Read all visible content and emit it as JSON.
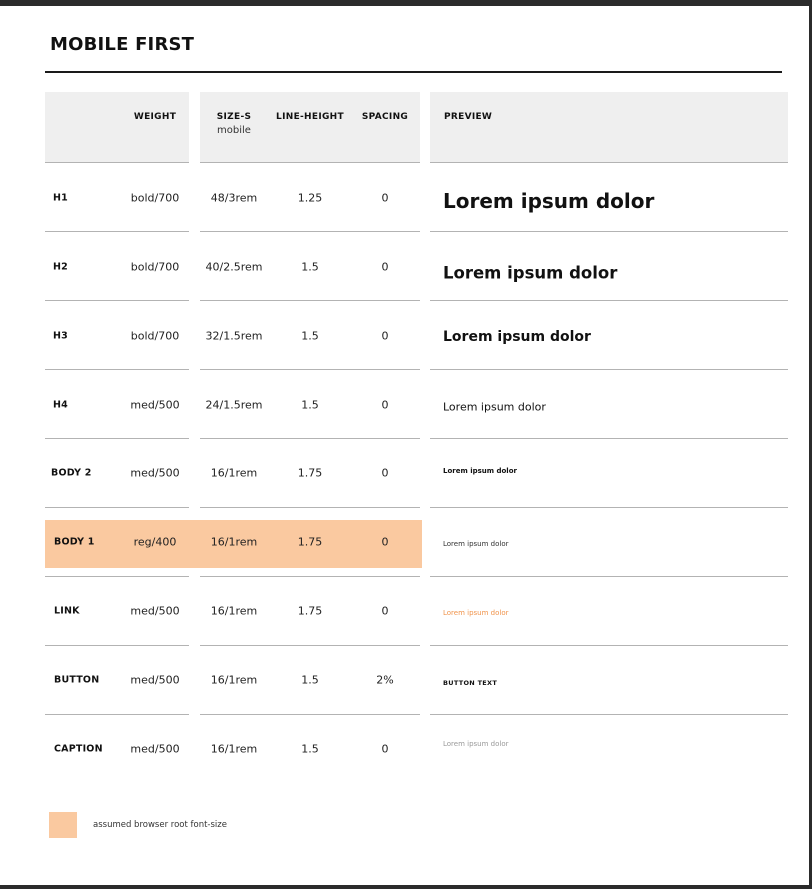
{
  "title": "MOBILE FIRST",
  "headers": {
    "weight": "WEIGHT",
    "size": "SIZE-S",
    "size_sub": "mobile",
    "line_height": "LINE-HEIGHT",
    "spacing": "SPACING",
    "preview": "PREVIEW"
  },
  "rows": [
    {
      "name": "H1",
      "weight": "bold/700",
      "size": "48/3rem",
      "line_height": "1.25",
      "spacing": "0",
      "preview": "Lorem ipsum dolor"
    },
    {
      "name": "H2",
      "weight": "bold/700",
      "size": "40/2.5rem",
      "line_height": "1.5",
      "spacing": "0",
      "preview": "Lorem ipsum dolor"
    },
    {
      "name": "H3",
      "weight": "bold/700",
      "size": "32/1.5rem",
      "line_height": "1.5",
      "spacing": "0",
      "preview": "Lorem ipsum dolor"
    },
    {
      "name": "H4",
      "weight": "med/500",
      "size": "24/1.5rem",
      "line_height": "1.5",
      "spacing": "0",
      "preview": "Lorem ipsum dolor"
    },
    {
      "name": "BODY 2",
      "weight": "med/500",
      "size": "16/1rem",
      "line_height": "1.75",
      "spacing": "0",
      "preview": "Lorem ipsum dolor"
    },
    {
      "name": "BODY 1",
      "weight": "reg/400",
      "size": "16/1rem",
      "line_height": "1.75",
      "spacing": "0",
      "preview": "Lorem ipsum dolor"
    },
    {
      "name": "LINK",
      "weight": "med/500",
      "size": "16/1rem",
      "line_height": "1.75",
      "spacing": "0",
      "preview": "Lorem ipsum dolor"
    },
    {
      "name": "BUTTON",
      "weight": "med/500",
      "size": "16/1rem",
      "line_height": "1.5",
      "spacing": "2%",
      "preview": "BUTTON TEXT"
    },
    {
      "name": "CAPTION",
      "weight": "med/500",
      "size": "16/1rem",
      "line_height": "1.5",
      "spacing": "0",
      "preview": "Lorem ipsum dolor"
    }
  ],
  "legend": {
    "text": "assumed browser root font-size",
    "color": "#fac9a0"
  },
  "colors": {
    "highlight": "#fac9a0",
    "link": "#f0944c",
    "caption": "#9a9a9a",
    "header_bg": "#efefef"
  }
}
